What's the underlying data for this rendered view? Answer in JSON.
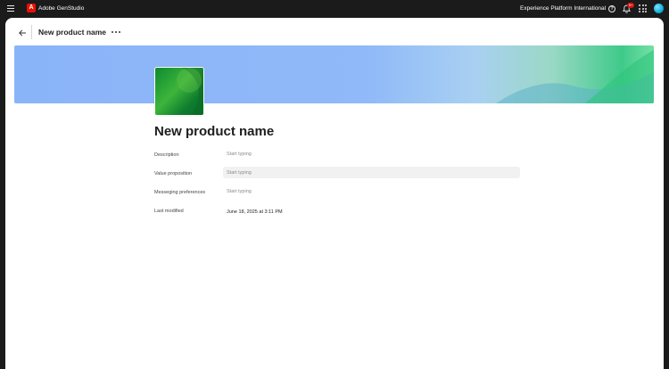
{
  "topbar": {
    "app_name": "Adobe GenStudio",
    "logo_letter": "A",
    "org_name": "Experience Platform International",
    "help_symbol": "?",
    "notifications_badge": "9+"
  },
  "header": {
    "title": "New product name"
  },
  "product": {
    "name": "New product name"
  },
  "fields": {
    "description": {
      "label": "Description",
      "placeholder": "Start typing"
    },
    "value_proposition": {
      "label": "Value proposition",
      "placeholder": "Start typing"
    },
    "messaging_preferences": {
      "label": "Messeging preferences",
      "placeholder": "Start typing"
    },
    "last_modified": {
      "label": "Last modified",
      "value": "June 18, 2025 at 3:11 PM"
    }
  },
  "colors": {
    "brand_red": "#eb1000",
    "topbar_bg": "#1b1b1b",
    "banner_blue": "#8ab4f8",
    "banner_green": "#3fca8a"
  },
  "icons": [
    "menu-icon",
    "adobe-logo-icon",
    "help-icon",
    "bell-icon",
    "apps-grid-icon",
    "avatar",
    "back-arrow-icon",
    "more-icon"
  ]
}
